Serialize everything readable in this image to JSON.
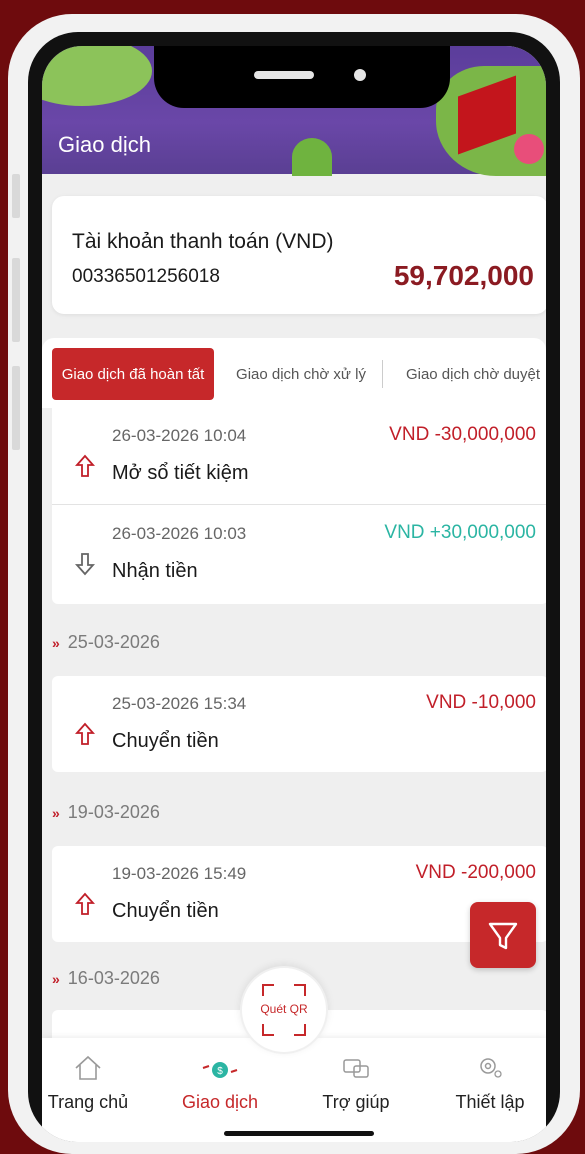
{
  "header": {
    "title": "Giao dịch"
  },
  "account": {
    "type": "Tài khoản thanh toán (VND)",
    "number": "00336501256018",
    "balance": "59,702,000"
  },
  "tabs": [
    {
      "label": "Giao dịch đã hoàn tất",
      "active": true
    },
    {
      "label": "Giao dịch chờ xử lý",
      "active": false
    },
    {
      "label": "Giao dịch chờ duyệt",
      "active": false
    }
  ],
  "groups": [
    {
      "date": "",
      "items": [
        {
          "time": "26-03-2026 10:04",
          "desc": "Mở sổ tiết kiệm",
          "amount": "VND -30,000,000",
          "direction": "out"
        },
        {
          "time": "26-03-2026 10:03",
          "desc": "Nhận tiền",
          "amount": "VND +30,000,000",
          "direction": "in"
        }
      ]
    },
    {
      "date": "25-03-2026",
      "items": [
        {
          "time": "25-03-2026 15:34",
          "desc": "Chuyển tiền",
          "amount": "VND -10,000",
          "direction": "out"
        }
      ]
    },
    {
      "date": "19-03-2026",
      "items": [
        {
          "time": "19-03-2026 15:49",
          "desc": "Chuyển tiền",
          "amount": "VND -200,000",
          "direction": "out"
        }
      ]
    },
    {
      "date": "16-03-2026",
      "items": []
    }
  ],
  "qr": {
    "label": "Quét QR"
  },
  "nav": [
    {
      "label": "Trang chủ",
      "icon": "home-icon",
      "active": false
    },
    {
      "label": "Giao dịch",
      "icon": "transactions-icon",
      "active": true
    },
    {
      "label": "Trợ giúp",
      "icon": "help-chat-icon",
      "active": false
    },
    {
      "label": "Thiết lập",
      "icon": "settings-icon",
      "active": false
    }
  ],
  "colors": {
    "accent": "#c6282a",
    "balance": "#8b1b22",
    "positive": "#2bb5a3",
    "negative": "#c11f29"
  }
}
